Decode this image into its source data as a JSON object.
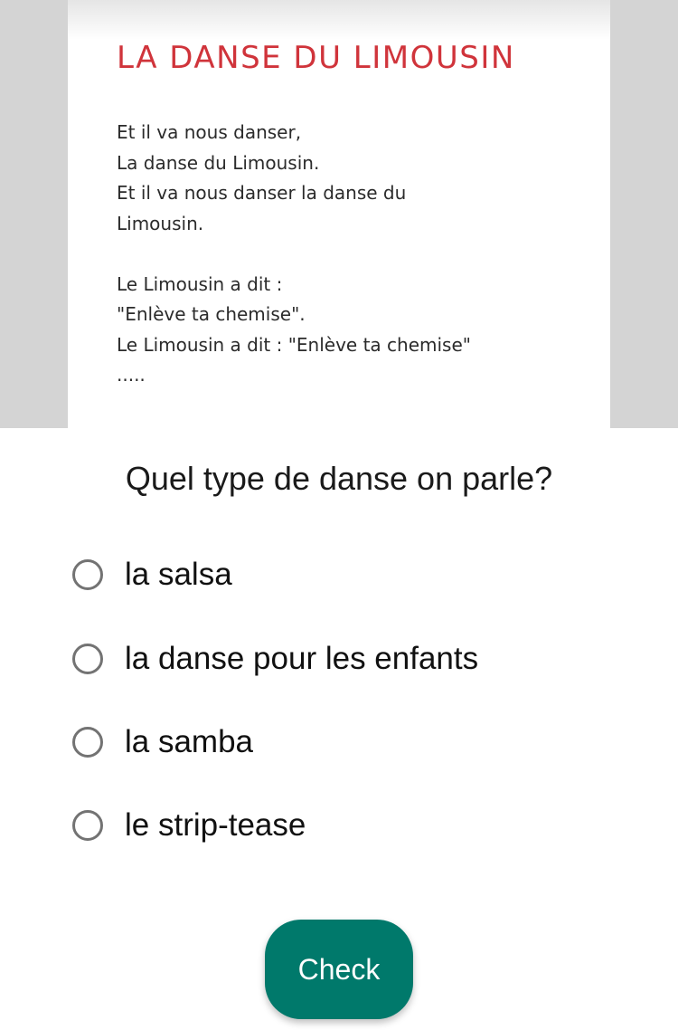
{
  "image": {
    "title": "LA DANSE DU LIMOUSIN",
    "lyrics": [
      "Et il va nous danser,",
      "La danse du Limousin.",
      "Et il va nous danser la danse du",
      "Limousin.",
      "",
      "Le Limousin a dit :",
      "\"Enlève ta chemise\".",
      "Le Limousin a dit : \"Enlève ta chemise\"",
      "....."
    ]
  },
  "question": "Quel type de danse on parle?",
  "options": [
    {
      "label": "la salsa",
      "selected": false
    },
    {
      "label": "la danse pour les enfants",
      "selected": false
    },
    {
      "label": "la samba",
      "selected": false
    },
    {
      "label": "le strip-tease",
      "selected": false
    }
  ],
  "check_button": {
    "label": "Check"
  },
  "colors": {
    "title": "#d0343b",
    "button": "#00796b",
    "radio_border": "#737373",
    "band": "#d4d4d4"
  }
}
